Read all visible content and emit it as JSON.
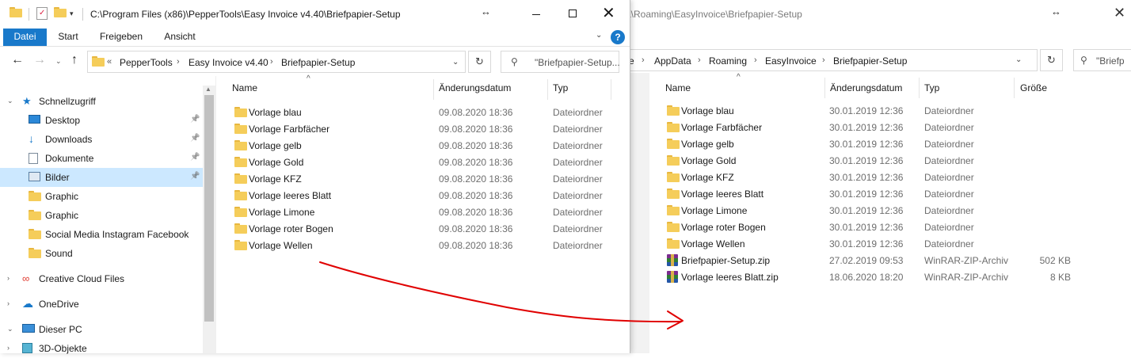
{
  "right_window": {
    "title": "a\\Roaming\\EasyInvoice\\Briefpapier-Setup",
    "breadcrumb": [
      "re",
      "AppData",
      "Roaming",
      "EasyInvoice",
      "Briefpapier-Setup"
    ],
    "search_placeholder": "\"Briefp",
    "columns": [
      "Name",
      "Änderungsdatum",
      "Typ",
      "Größe"
    ],
    "files": [
      {
        "name": "Vorlage blau",
        "date": "30.01.2019 12:36",
        "type": "Dateiordner",
        "size": "",
        "icon": "folder-icon"
      },
      {
        "name": "Vorlage Farbfächer",
        "date": "30.01.2019 12:36",
        "type": "Dateiordner",
        "size": "",
        "icon": "folder-icon"
      },
      {
        "name": "Vorlage gelb",
        "date": "30.01.2019 12:36",
        "type": "Dateiordner",
        "size": "",
        "icon": "folder-icon"
      },
      {
        "name": "Vorlage Gold",
        "date": "30.01.2019 12:36",
        "type": "Dateiordner",
        "size": "",
        "icon": "folder-icon"
      },
      {
        "name": "Vorlage KFZ",
        "date": "30.01.2019 12:36",
        "type": "Dateiordner",
        "size": "",
        "icon": "folder-icon"
      },
      {
        "name": "Vorlage leeres Blatt",
        "date": "30.01.2019 12:36",
        "type": "Dateiordner",
        "size": "",
        "icon": "folder-icon"
      },
      {
        "name": "Vorlage Limone",
        "date": "30.01.2019 12:36",
        "type": "Dateiordner",
        "size": "",
        "icon": "folder-icon"
      },
      {
        "name": "Vorlage roter Bogen",
        "date": "30.01.2019 12:36",
        "type": "Dateiordner",
        "size": "",
        "icon": "folder-icon"
      },
      {
        "name": "Vorlage Wellen",
        "date": "30.01.2019 12:36",
        "type": "Dateiordner",
        "size": "",
        "icon": "folder-icon"
      },
      {
        "name": "Briefpapier-Setup.zip",
        "date": "27.02.2019 09:53",
        "type": "WinRAR-ZIP-Archiv",
        "size": "502 KB",
        "icon": "winrar-zip-icon"
      },
      {
        "name": "Vorlage leeres Blatt.zip",
        "date": "18.06.2020 18:20",
        "type": "WinRAR-ZIP-Archiv",
        "size": "8 KB",
        "icon": "winrar-zip-icon"
      }
    ]
  },
  "left_window": {
    "title": "C:\\Program Files (x86)\\PepperTools\\Easy Invoice v4.40\\Briefpapier-Setup",
    "ribbon_tabs": [
      "Datei",
      "Start",
      "Freigeben",
      "Ansicht"
    ],
    "active_tab": "Datei",
    "help_label": "?",
    "address_overflow": "«",
    "breadcrumb": [
      "PepperTools",
      "Easy Invoice v4.40",
      "Briefpapier-Setup"
    ],
    "search_placeholder": "\"Briefpapier-Setup...",
    "columns": [
      "Name",
      "Änderungsdatum",
      "Typ"
    ],
    "nav_items": [
      {
        "label": "Schnellzugriff",
        "icon": "star-icon",
        "pinned": false,
        "expander": "expanded",
        "selected": false
      },
      {
        "label": "Desktop",
        "icon": "desktop-icon",
        "pinned": true,
        "expander": "",
        "selected": false
      },
      {
        "label": "Downloads",
        "icon": "download-icon",
        "pinned": true,
        "expander": "",
        "selected": false
      },
      {
        "label": "Dokumente",
        "icon": "documents-icon",
        "pinned": true,
        "expander": "",
        "selected": false
      },
      {
        "label": "Bilder",
        "icon": "pictures-icon",
        "pinned": true,
        "expander": "",
        "selected": true
      },
      {
        "label": "Graphic",
        "icon": "folder-icon",
        "pinned": false,
        "expander": "",
        "selected": false
      },
      {
        "label": "Graphic",
        "icon": "folder-icon",
        "pinned": false,
        "expander": "",
        "selected": false
      },
      {
        "label": "Social Media Instagram Facebook",
        "icon": "folder-icon",
        "pinned": false,
        "expander": "",
        "selected": false
      },
      {
        "label": "Sound",
        "icon": "folder-icon",
        "pinned": false,
        "expander": "",
        "selected": false
      },
      {
        "label": "Creative Cloud Files",
        "icon": "creative-cloud-icon",
        "pinned": false,
        "expander": "collapsed",
        "selected": false
      },
      {
        "label": "OneDrive",
        "icon": "onedrive-icon",
        "pinned": false,
        "expander": "collapsed",
        "selected": false
      },
      {
        "label": "Dieser PC",
        "icon": "this-pc-icon",
        "pinned": false,
        "expander": "expanded",
        "selected": false
      },
      {
        "label": "3D-Objekte",
        "icon": "3d-objects-icon",
        "pinned": false,
        "expander": "collapsed",
        "selected": false
      }
    ],
    "files": [
      {
        "name": "Vorlage blau",
        "date": "09.08.2020 18:36",
        "type": "Dateiordner"
      },
      {
        "name": "Vorlage Farbfächer",
        "date": "09.08.2020 18:36",
        "type": "Dateiordner"
      },
      {
        "name": "Vorlage gelb",
        "date": "09.08.2020 18:36",
        "type": "Dateiordner"
      },
      {
        "name": "Vorlage Gold",
        "date": "09.08.2020 18:36",
        "type": "Dateiordner"
      },
      {
        "name": "Vorlage KFZ",
        "date": "09.08.2020 18:36",
        "type": "Dateiordner"
      },
      {
        "name": "Vorlage leeres Blatt",
        "date": "09.08.2020 18:36",
        "type": "Dateiordner"
      },
      {
        "name": "Vorlage Limone",
        "date": "09.08.2020 18:36",
        "type": "Dateiordner"
      },
      {
        "name": "Vorlage roter Bogen",
        "date": "09.08.2020 18:36",
        "type": "Dateiordner"
      },
      {
        "name": "Vorlage Wellen",
        "date": "09.08.2020 18:36",
        "type": "Dateiordner"
      }
    ]
  },
  "annotation": {
    "color": "#e00000",
    "description_icon": "red-arrow-annotation"
  },
  "colors": {
    "accent": "#1979ca",
    "selection": "#cce8ff",
    "folder": "#f5cd5a"
  }
}
